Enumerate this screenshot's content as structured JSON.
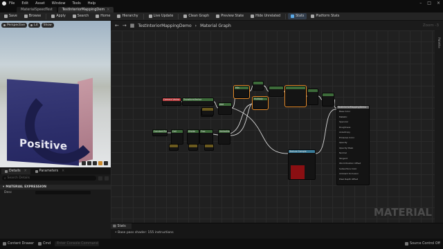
{
  "menu": [
    "File",
    "Edit",
    "Asset",
    "Window",
    "Tools",
    "Help"
  ],
  "tabs": [
    {
      "label": "MaterialSpeedTest"
    },
    {
      "label": "TestInteriorMappingDem"
    }
  ],
  "toolbar": [
    {
      "label": "Save",
      "color": "#aaaaaa"
    },
    {
      "label": "Browse",
      "color": "#aaaaaa"
    },
    {
      "label": "Apply",
      "color": "#aaaaaa"
    },
    {
      "label": "Search",
      "color": "#aaaaaa"
    },
    {
      "label": "Home",
      "color": "#aaaaaa"
    },
    {
      "label": "Hierarchy",
      "color": "#aaaaaa"
    },
    {
      "label": "Live Update",
      "color": "#aaaaaa"
    },
    {
      "label": "Clean Graph",
      "color": "#aaaaaa"
    },
    {
      "label": "Preview State",
      "color": "#aaaaaa"
    },
    {
      "label": "Hide Unrelated",
      "color": "#aaaaaa"
    },
    {
      "label": "Stats",
      "color": "#5aa9e6"
    },
    {
      "label": "Platform Stats",
      "color": "#aaaaaa"
    }
  ],
  "viewport": {
    "buttons": [
      "Perspective",
      "Lit",
      "Show"
    ],
    "mesh_text": "Positive"
  },
  "details": {
    "tab_details": "Details",
    "tab_parameters": "Parameters",
    "search_placeholder": "Search Details",
    "section": "MATERIAL EXPRESSION",
    "prop_label": "Desc"
  },
  "graph": {
    "breadcrumb_root": "TestInteriorMappingDemo",
    "breadcrumb_leaf": "Material Graph",
    "zoom": "Zoom -3",
    "side_label": "Palette",
    "watermark": "MATERIAL",
    "nodes": [
      {
        "title": "Camera Vector",
        "color": "#c0393b"
      },
      {
        "title": "TransformVector",
        "color": "#3d6b3a"
      },
      {
        "title": "Multiply",
        "color": "#3d6b3a"
      },
      {
        "title": "Add",
        "color": "#3d6b3a"
      },
      {
        "title": "Constant3Vector",
        "color": "#3d6b3a"
      },
      {
        "title": "Ceil",
        "color": "#3d6b3a"
      },
      {
        "title": "Divide",
        "color": "#3d6b3a"
      },
      {
        "title": "Frac",
        "color": "#3d6b3a"
      },
      {
        "title": "VertexNormalWS",
        "color": "#3d6b3a"
      },
      {
        "title": "Min",
        "color": "#3d6b3a"
      },
      {
        "title": "Multiply",
        "color": "#3d6b3a"
      },
      {
        "title": "Texture Sample",
        "color": "#3a7d9a"
      },
      {
        "title": "TestInteriorMappingDemo",
        "color": "#6b6b6b"
      }
    ],
    "result_pins": [
      "Base Color",
      "Metallic",
      "Specular",
      "Roughness",
      "Anisotropy",
      "Emissive Color",
      "Opacity",
      "Opacity Mask",
      "Normal",
      "Tangent",
      "World Position Offset",
      "Subsurface Color",
      "Ambient Occlusion",
      "Pixel Depth Offset"
    ]
  },
  "stats": {
    "tab": "Stats",
    "line": "Base pass shader: 155 instructions"
  },
  "statusbar": {
    "content_drawer": "Content Drawer",
    "cmd": "Cmd",
    "console_placeholder": "Enter Console Command",
    "source_control": "Source Control Off"
  }
}
